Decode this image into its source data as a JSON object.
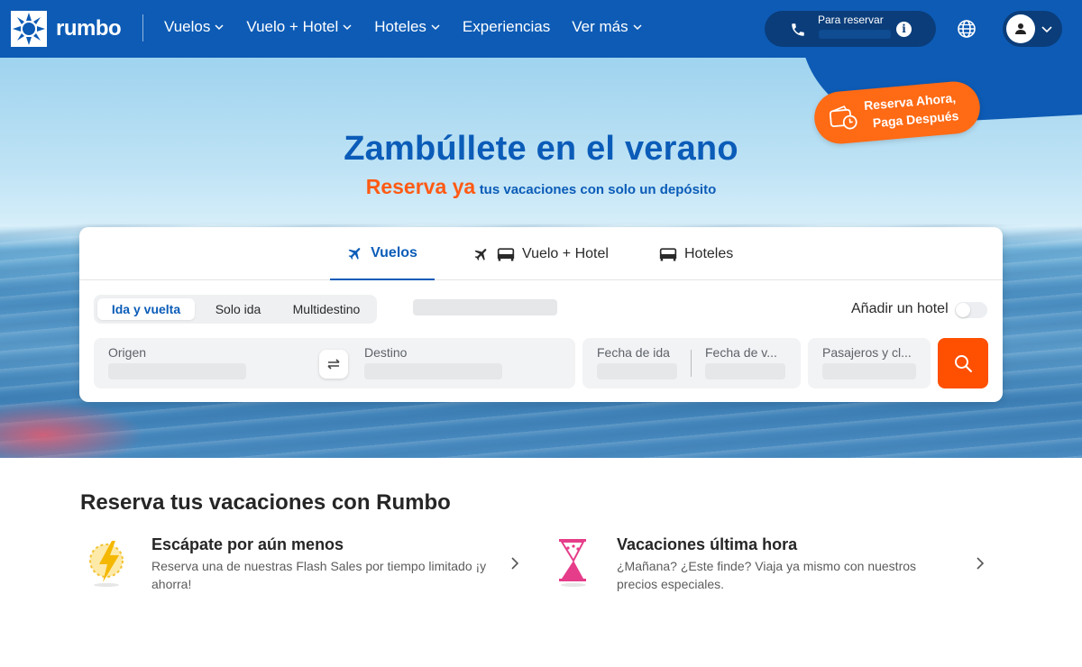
{
  "header": {
    "logo_text": "rumbo",
    "nav": [
      {
        "label": "Vuelos",
        "has_dropdown": true
      },
      {
        "label": "Vuelo + Hotel",
        "has_dropdown": true
      },
      {
        "label": "Hoteles",
        "has_dropdown": true
      },
      {
        "label": "Experiencias",
        "has_dropdown": false
      },
      {
        "label": "Ver más",
        "has_dropdown": true
      }
    ],
    "phone_label": "Para reservar",
    "icons": {
      "phone": "phone-icon",
      "info": "info-icon",
      "globe": "globe-icon",
      "account": "user-icon"
    }
  },
  "hero": {
    "title": "Zambúllete en el verano",
    "subtitle_accent": "Reserva ya",
    "subtitle_rest": "tus vacaciones con solo un depósito",
    "badge_line1": "Reserva Ahora,",
    "badge_line2": "Paga Después"
  },
  "search": {
    "tabs": [
      {
        "label": "Vuelos",
        "icon": "plane-icon",
        "active": true
      },
      {
        "label": "Vuelo + Hotel",
        "icon": "plane-bed-icon",
        "active": false
      },
      {
        "label": "Hoteles",
        "icon": "bed-icon",
        "active": false
      }
    ],
    "trip_types": [
      {
        "label": "Ida y vuelta",
        "active": true
      },
      {
        "label": "Solo ida",
        "active": false
      },
      {
        "label": "Multidestino",
        "active": false
      }
    ],
    "add_hotel_label": "Añadir un hotel",
    "add_hotel_enabled": false,
    "fields": {
      "origin": "Origen",
      "destination": "Destino",
      "departure": "Fecha de ida",
      "return": "Fecha de v...",
      "passengers": "Pasajeros y cl..."
    }
  },
  "section": {
    "title": "Reserva tus vacaciones con Rumbo",
    "cards": [
      {
        "title": "Escápate por aún menos",
        "description": "Reserva una de nuestras Flash Sales por tiempo limitado ¡y ahorra!",
        "icon": "lightning-icon"
      },
      {
        "title": "Vacaciones última hora",
        "description": "¿Mañana? ¿Este finde? Viaja ya mismo con nuestros precios especiales.",
        "icon": "hourglass-icon"
      }
    ]
  },
  "colors": {
    "header_bg": "#0d5bb5",
    "brand_blue": "#0b5cb8",
    "accent_orange": "#ff4f00",
    "badge_orange": "#ff6a14"
  }
}
